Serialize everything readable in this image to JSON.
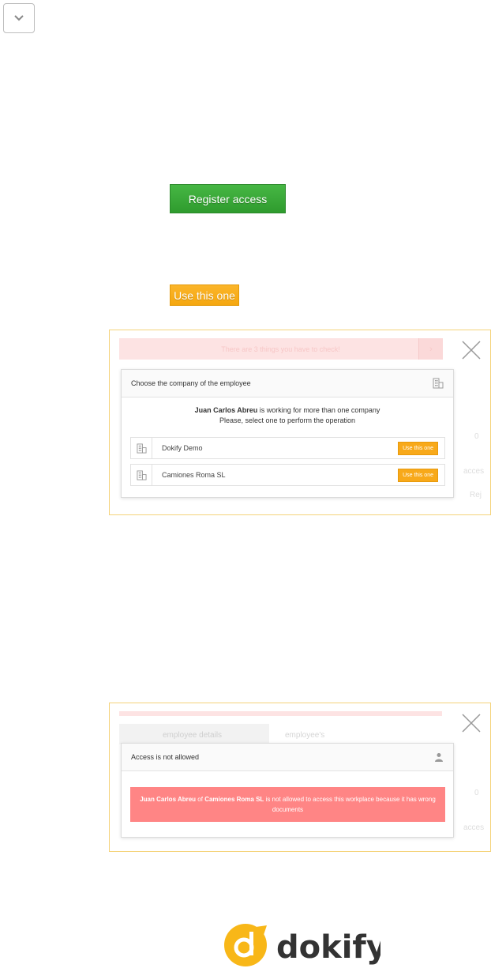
{
  "collapse": {
    "icon": "chevron-down-icon"
  },
  "buttons": {
    "register": "Register access",
    "use_this_one": "Use this one"
  },
  "panel1": {
    "background": {
      "alert": "There are 3 things you have to check!",
      "right_label_1": "acces",
      "right_label_2": "Rej",
      "right_label_3": "0"
    },
    "dialog": {
      "title": "Choose the company of the employee",
      "title_icon": "building-icon",
      "employee_name": "Juan Carlos Abreu",
      "message_rest": " is working for more than one company",
      "message_line2": "Please, select one to perform the operation",
      "companies": [
        {
          "name": "Dokify Demo",
          "action": "Use this one",
          "icon": "building-icon"
        },
        {
          "name": "Camiones Roma SL",
          "action": "Use this one",
          "icon": "building-icon"
        }
      ]
    }
  },
  "panel2": {
    "background": {
      "tab1": "employee details",
      "tab2": "employee's",
      "right_label_1": "acces",
      "right_label_2": "0"
    },
    "dialog": {
      "title": "Access is not allowed",
      "title_icon": "user-icon",
      "employee_name": "Juan Carlos Abreu",
      "of_word": " of ",
      "company_name": "Camiones Roma SL",
      "message_rest": " is not allowed to access this workplace because it has wrong documents"
    }
  },
  "brand": {
    "name": "dokify",
    "colors": {
      "yellow": "#f8b718",
      "dark": "#333333"
    }
  }
}
